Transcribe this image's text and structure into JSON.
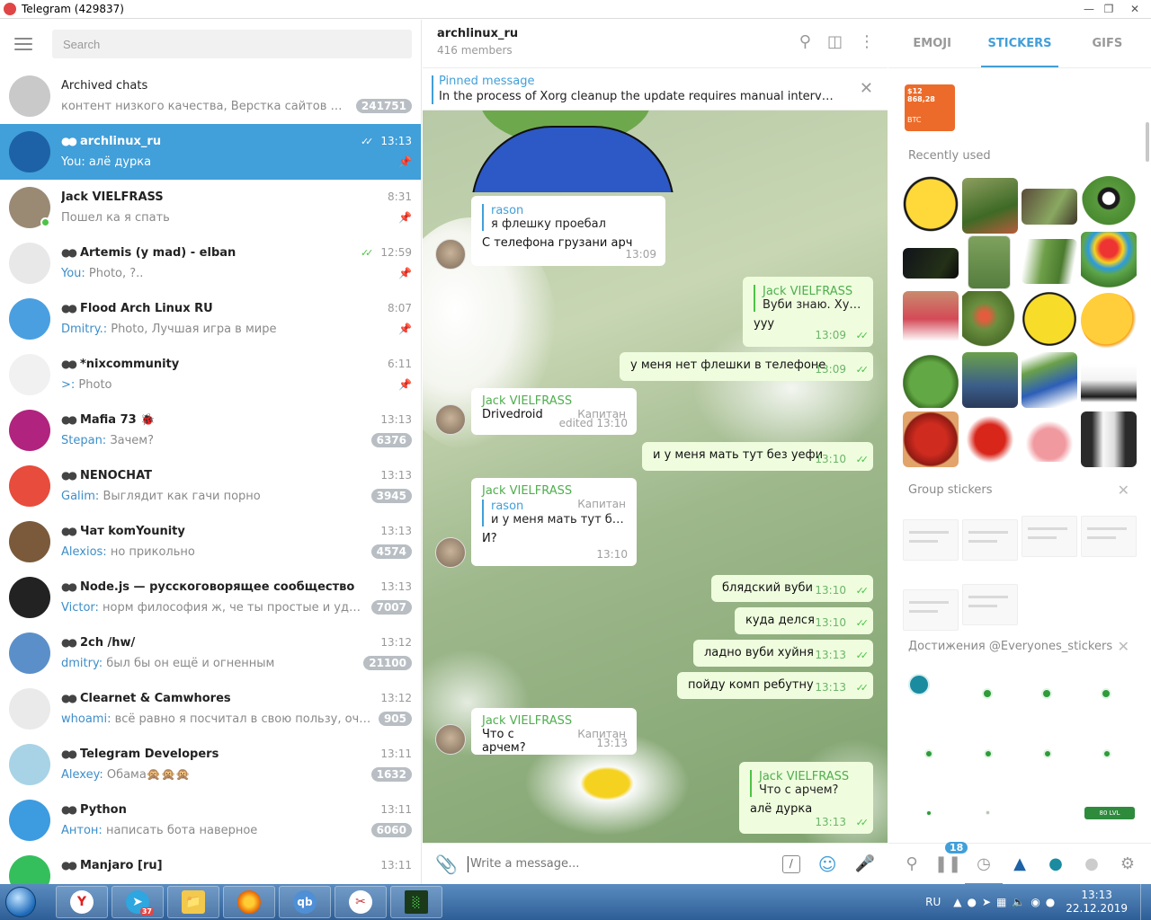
{
  "window": {
    "title": "Telegram (429837)"
  },
  "search": {
    "placeholder": "Search"
  },
  "chats": [
    {
      "name": "Archived chats",
      "preview": "контент низкого качества, Верстка сайтов HTML/...",
      "badge": "241751",
      "avatar_color": "#c9c9c9"
    },
    {
      "name": "archlinux_ru",
      "time": "13:13",
      "sender": "You:",
      "preview": " алё дурка",
      "avatar_color": "#1d62a6"
    },
    {
      "name": "Jack VIELFRASS",
      "time": "8:31",
      "preview": "Пошел ка я спать",
      "avatar_color": "#9a8a74"
    },
    {
      "name": "Artemis (y mad) - elban",
      "time": "12:59",
      "sender": "You:",
      "preview": " Photo, ?..",
      "avatar_color": "#e8e8e8"
    },
    {
      "name": "Flood Arch Linux RU",
      "time": "8:07",
      "sender": "Dmitry.:",
      "preview": " Photo, Лучшая игра в мире",
      "avatar_color": "#4a9fe0"
    },
    {
      "name": "*nixcommunity",
      "time": "6:11",
      "sender": ">:",
      "preview": " Photo",
      "avatar_color": "#f1f1f1"
    },
    {
      "name": "Mafia 73 🐞",
      "time": "13:13",
      "sender": "Stepan:",
      "preview": " Зачем?",
      "badge": "6376",
      "avatar_color": "#b0237e"
    },
    {
      "name": "NENOCHAT",
      "time": "13:13",
      "sender": "Galim:",
      "preview": " Выглядит как гачи порно",
      "badge": "3945",
      "avatar_color": "#e74c3c"
    },
    {
      "name": "Чат komYounity",
      "time": "13:13",
      "sender": "Alexios:",
      "preview": " но прикольно",
      "badge": "4574",
      "avatar_color": "#7a5a3a"
    },
    {
      "name": "Node.js — русскоговорящее сообщество",
      "time": "13:13",
      "sender": "Victor:",
      "preview": " норм философия ж, че ты простые и удобные",
      "badge": "7007",
      "avatar_color": "#222222"
    },
    {
      "name": "2ch /hw/",
      "time": "13:12",
      "sender": "dmitry:",
      "preview": " был бы он ещё и огненным",
      "badge": "21100",
      "avatar_color": "#5b8fc9"
    },
    {
      "name": "Clearnet & Camwhores",
      "time": "13:12",
      "sender": "whoami:",
      "preview": " всё равно я посчитал в свою пользу, очевидно...",
      "badge": "905",
      "avatar_color": "#eaeaea"
    },
    {
      "name": "Telegram Developers",
      "time": "13:11",
      "sender": "Alexey:",
      "preview": " Обама🙊🙊🙊",
      "badge": "1632",
      "avatar_color": "#a8d3e6"
    },
    {
      "name": "Python",
      "time": "13:11",
      "sender": "Антон:",
      "preview": " написать бота наверное",
      "badge": "6060",
      "avatar_color": "#3d9be0"
    },
    {
      "name": "Manjaro [ru]",
      "time": "13:11",
      "avatar_color": "#35bf5c"
    }
  ],
  "conversation": {
    "title": "archlinux_ru",
    "members": "416 members",
    "pinned_title": "Pinned message",
    "pinned_text": "In the process of Xorg cleanup the update requires manual intervention ...",
    "composer_placeholder": "Write a message..."
  },
  "messages": [
    {
      "dir": "in",
      "reply_name": "rason",
      "reply_text": "я флешку проебал",
      "text": "С телефона грузани арч",
      "time": "13:09"
    },
    {
      "dir": "out",
      "reply_name": "Jack VIELFRASS",
      "reply_text": "Вуби знаю. Хуйня",
      "text": "ууу",
      "time": "13:09"
    },
    {
      "dir": "out",
      "text": "у меня нет флешки в телефоне",
      "time": "13:09"
    },
    {
      "dir": "in",
      "author": "Jack VIELFRASS",
      "rank": "Капитан",
      "text": "Drivedroid",
      "time": "edited 13:10"
    },
    {
      "dir": "out",
      "text": "и у меня мать тут без уефи",
      "time": "13:10"
    },
    {
      "dir": "in",
      "author": "Jack VIELFRASS",
      "rank": "Капитан",
      "reply_name": "rason",
      "reply_text": "и у меня мать тут без ...",
      "text": "И?",
      "time": "13:10"
    },
    {
      "dir": "out",
      "text": "блядский вуби",
      "time": "13:10"
    },
    {
      "dir": "out",
      "text": "куда делся",
      "time": "13:10"
    },
    {
      "dir": "out",
      "text": "ладно вуби хуйня",
      "time": "13:13"
    },
    {
      "dir": "out",
      "text": "пойду комп ребутну",
      "time": "13:13"
    },
    {
      "dir": "in",
      "author": "Jack VIELFRASS",
      "rank": "Капитан",
      "text": "Что с арчем?",
      "time": "13:13"
    },
    {
      "dir": "out",
      "reply_name": "Jack VIELFRASS",
      "reply_text": "Что с арчем?",
      "text": "алё дурка",
      "time": "13:13"
    }
  ],
  "stickers_panel": {
    "tabs": [
      "EMOJI",
      "STICKERS",
      "GIFS"
    ],
    "promo_line1": "$12 868,28",
    "promo_line2": "BTC",
    "recently_used_title": "Recently used",
    "group_stickers_title": "Group stickers",
    "achievements_title": "Достижения @Everyones_stickers",
    "badge_label": "80 LVL",
    "recent_count": "18"
  },
  "taskbar": {
    "telegram_count": "37",
    "lang": "RU",
    "time": "13:13",
    "date": "22.12.2019"
  }
}
